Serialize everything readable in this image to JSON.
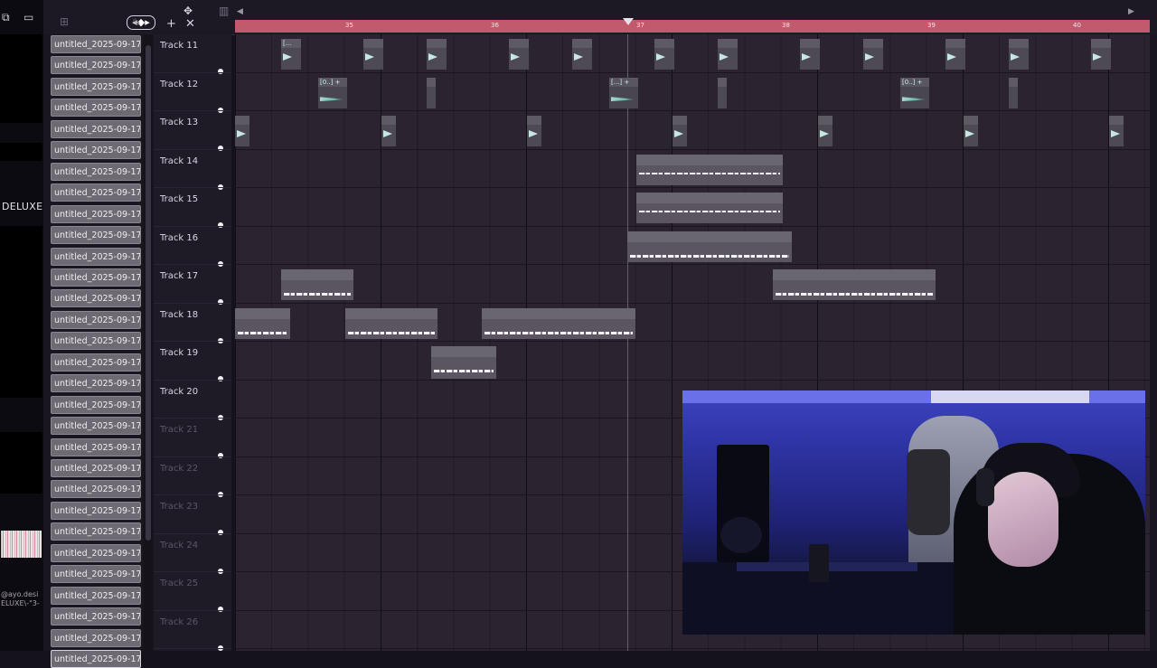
{
  "left_panel": {
    "badge_text": "DELUXE",
    "stream_label_lines": [
      "@ayo.desi",
      "ELUXE\\-\"3-"
    ]
  },
  "toolbar": {
    "snap_icon": "magnet-icon",
    "icons": [
      "folder-icon",
      "browser-icon",
      "piano-icon",
      "draw-icon",
      "add-icon",
      "close-icon",
      "menu-icon"
    ]
  },
  "pattern_list": {
    "items": [
      "untitled_2025-09-17 02...",
      "untitled_2025-09-17 02...",
      "untitled_2025-09-17 02...",
      "untitled_2025-09-17 02...",
      "untitled_2025-09-17 02...",
      "untitled_2025-09-17 02...",
      "untitled_2025-09-17 02...",
      "untitled_2025-09-17 02...",
      "untitled_2025-09-17 02...",
      "untitled_2025-09-17 02...",
      "untitled_2025-09-17 02...",
      "untitled_2025-09-17 02...",
      "untitled_2025-09-17 02...",
      "untitled_2025-09-17 02...",
      "untitled_2025-09-17 02...",
      "untitled_2025-09-17 02...",
      "untitled_2025-09-17 02...",
      "untitled_2025-09-17 02...",
      "untitled_2025-09-17 02...",
      "untitled_2025-09-17 02...",
      "untitled_2025-09-17 02...",
      "untitled_2025-09-17 02...",
      "untitled_2025-09-17 02...",
      "untitled_2025-09-17 02...",
      "untitled_2025-09-17 02...",
      "untitled_2025-09-17 02...",
      "untitled_2025-09-17 02...",
      "untitled_2025-09-17 02...",
      "untitled_2025-09-17 02...",
      "untitled_2025-09-17 02..."
    ]
  },
  "tracks": [
    {
      "name": "Track 11",
      "dim": false
    },
    {
      "name": "Track 12",
      "dim": false
    },
    {
      "name": "Track 13",
      "dim": false
    },
    {
      "name": "Track 14",
      "dim": false
    },
    {
      "name": "Track 15",
      "dim": false
    },
    {
      "name": "Track 16",
      "dim": false
    },
    {
      "name": "Track 17",
      "dim": false
    },
    {
      "name": "Track 18",
      "dim": false
    },
    {
      "name": "Track 19",
      "dim": false
    },
    {
      "name": "Track 20",
      "dim": false
    },
    {
      "name": "Track 21",
      "dim": true
    },
    {
      "name": "Track 22",
      "dim": true
    },
    {
      "name": "Track 23",
      "dim": true
    },
    {
      "name": "Track 24",
      "dim": true
    },
    {
      "name": "Track 25",
      "dim": true
    },
    {
      "name": "Track 26",
      "dim": true
    }
  ],
  "ruler": {
    "bars": [
      "35",
      "36",
      "37",
      "38",
      "39",
      "40"
    ]
  },
  "clips": {
    "track11_label": "[...",
    "track12_a": "[0..] +",
    "track12_b": "[...] +",
    "track12_c": "[0..] +",
    "track14": "[F3Rc] · $iN®gul@r1tY ...eLL (@ayo.desire) +",
    "track15": "[CRASH] · $iN®gul@r1t...H (@ayo.desire) + (6)",
    "track16": "untitled_2025-09-17 02-33-38_Insert 32",
    "track17_a": "untitled_2...Insert 32",
    "track17_b": "untitled_2025-09-17 02-37-41_Insert 32",
    "track18_a": "untitle...sert 32",
    "track18_b": "untitled_202...03_Insert 32",
    "track18_c": "untitled_2025-09-17 01-58-39_Insert 32",
    "track19": "untitled_...nsert 32"
  },
  "colors": {
    "ruler": "#c05a6c",
    "playlist_bg": "#2b2330",
    "clip": "#5a5560"
  }
}
